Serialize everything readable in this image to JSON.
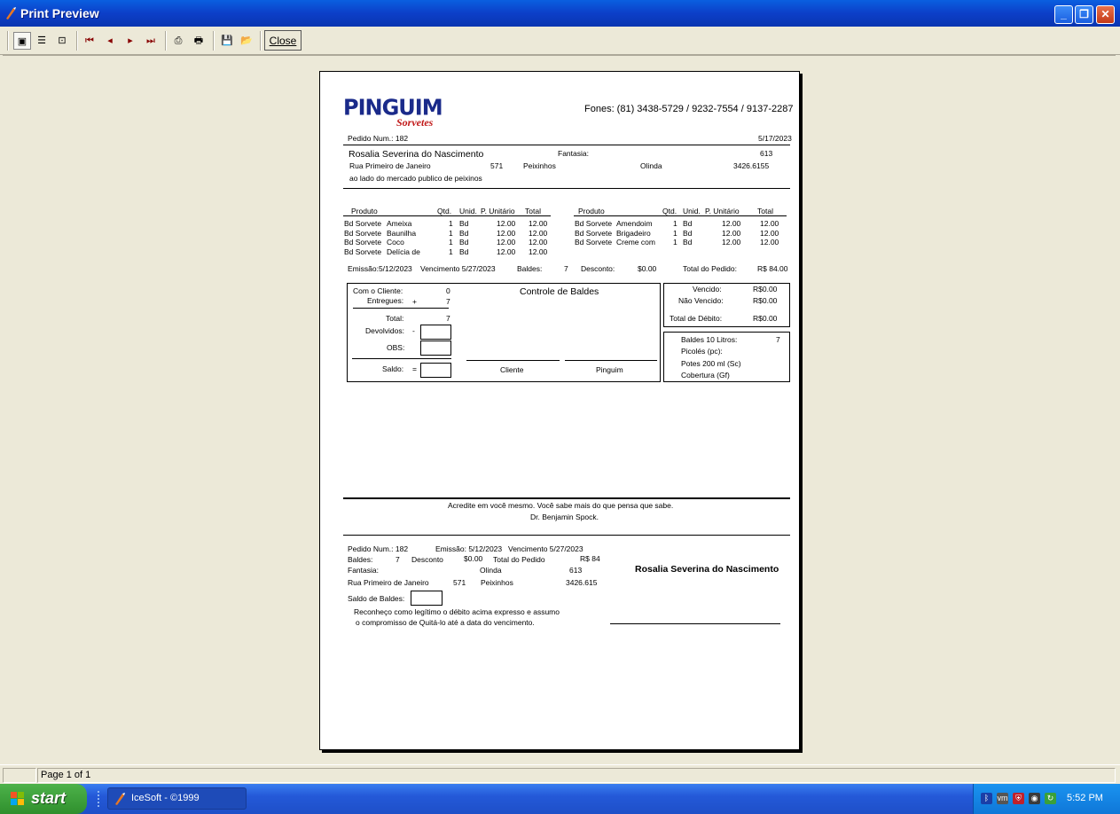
{
  "window": {
    "title": "Print Preview",
    "min_icon": "minimize-icon",
    "max_icon": "restore-icon",
    "close_icon": "close-icon"
  },
  "toolbar": {
    "close_label": "Close"
  },
  "status": {
    "page": "Page 1 of 1"
  },
  "report": {
    "logo": {
      "brand": "PINGUIM",
      "sub": "Sorvetes"
    },
    "phones": "Fones: (81) 3438-5729 / 9232-7554 / 9137-2287",
    "pedido_label": "Pedido Num.: 182",
    "date": "5/17/2023",
    "customer": "Rosalia Severina do Nascimento",
    "fantasia_label": "Fantasia:",
    "code": "613",
    "street": "Rua Primeiro de Janeiro",
    "number": "571",
    "district": "Peixinhos",
    "city": "Olinda",
    "phone": "3426.6155",
    "reference": "ao lado do mercado publico de peixinos",
    "headers": {
      "produto": "Produto",
      "qtd": "Qtd.",
      "unid": "Unid.",
      "punit": "P. Unitário",
      "total": "Total"
    },
    "items_left": [
      {
        "prod": "Bd Sorvete",
        "flavor": "Ameixa",
        "qtd": "1",
        "unid": "Bd",
        "punit": "12.00",
        "total": "12.00"
      },
      {
        "prod": "Bd Sorvete",
        "flavor": "Baunilha",
        "qtd": "1",
        "unid": "Bd",
        "punit": "12.00",
        "total": "12.00"
      },
      {
        "prod": "Bd Sorvete",
        "flavor": "Coco",
        "qtd": "1",
        "unid": "Bd",
        "punit": "12.00",
        "total": "12.00"
      },
      {
        "prod": "Bd Sorvete",
        "flavor": "Delícia de",
        "qtd": "1",
        "unid": "Bd",
        "punit": "12.00",
        "total": "12.00"
      }
    ],
    "items_right": [
      {
        "prod": "Bd Sorvete",
        "flavor": "Amendoim",
        "qtd": "1",
        "unid": "Bd",
        "punit": "12.00",
        "total": "12.00"
      },
      {
        "prod": "Bd Sorvete",
        "flavor": "Brigadeiro",
        "qtd": "1",
        "unid": "Bd",
        "punit": "12.00",
        "total": "12.00"
      },
      {
        "prod": "Bd Sorvete",
        "flavor": "Creme com",
        "qtd": "1",
        "unid": "Bd",
        "punit": "12.00",
        "total": "12.00"
      }
    ],
    "summary": {
      "emissao": "Emissão:5/12/2023",
      "vencimento": "Vencimento 5/27/2023",
      "baldes_label": "Baldes:",
      "baldes": "7",
      "desconto_label": "Desconto:",
      "desconto": "$0.00",
      "total_label": "Total do Pedido:",
      "total": "R$ 84.00"
    },
    "controle": {
      "title": "Controle de Baldes",
      "com_cliente_label": "Com o Cliente:",
      "com_cliente": "0",
      "entregues_label": "Entregues:",
      "plus": "+",
      "entregues": "7",
      "total_label": "Total:",
      "total": "7",
      "devolvidos_label": "Devolvidos:",
      "minus": "-",
      "obs_label": "OBS:",
      "saldo_label": "Saldo:",
      "eq": "=",
      "cliente_sig": "Cliente",
      "pinguim_sig": "Pinguim"
    },
    "debito": {
      "vencido_label": "Vencido:",
      "vencido": "R$0.00",
      "nao_vencido_label": "Não Vencido:",
      "nao_vencido": "R$0.00",
      "total_label": "Total de Débito:",
      "total": "R$0.00"
    },
    "estoque": {
      "baldes_label": "Baldes 10 Litros:",
      "baldes": "7",
      "picoles": "Picolés (pc):",
      "potes": "Potes 200 ml (Sc)",
      "cobertura": "Cobertura (Gf)"
    },
    "quote": {
      "line1": "Acredite em você mesmo. Você sabe mais do que pensa que sabe.",
      "line2": "Dr. Benjamin Spock."
    },
    "stub": {
      "pedido": "Pedido Num.: 182",
      "emissao": "Emissão: 5/12/2023",
      "vencimento": "Vencimento 5/27/2023",
      "baldes_label": "Baldes:",
      "baldes": "7",
      "desconto_label": "Desconto",
      "desconto": "$0.00",
      "total_label": "Total do Pedido",
      "total": "R$ 84",
      "fantasia": "Fantasia:",
      "city": "Olinda",
      "code": "613",
      "street": "Rua Primeiro de Janeiro",
      "number": "571",
      "district": "Peixinhos",
      "phone": "3426.615",
      "customer": "Rosalia Severina do Nascimento",
      "saldo_label": "Saldo de Baldes:",
      "declaration1": "Reconheço como legítimo o débito acima expresso e assumo",
      "declaration2": "o compromisso de Quitá-lo até a data do vencimento."
    }
  },
  "taskbar": {
    "start": "start",
    "item": "IceSoft - ©1999",
    "clock": "5:52 PM"
  }
}
